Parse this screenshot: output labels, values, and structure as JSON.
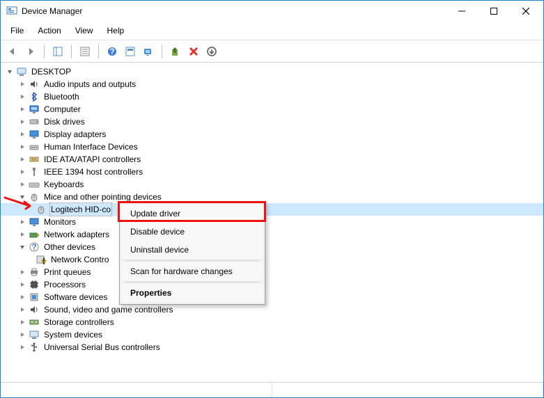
{
  "window": {
    "title": "Device Manager"
  },
  "menubar": {
    "file": "File",
    "action": "Action",
    "view": "View",
    "help": "Help"
  },
  "tree": {
    "root": "DESKTOP",
    "audio": "Audio inputs and outputs",
    "bluetooth": "Bluetooth",
    "computer": "Computer",
    "diskdrives": "Disk drives",
    "display": "Display adapters",
    "hid": "Human Interface Devices",
    "ide": "IDE ATA/ATAPI controllers",
    "ieee": "IEEE 1394 host controllers",
    "keyboards": "Keyboards",
    "mice": "Mice and other pointing devices",
    "logitech": "Logitech HID-co",
    "monitors": "Monitors",
    "network": "Network adapters",
    "other": "Other devices",
    "networkcontroller": "Network Contro",
    "printq": "Print queues",
    "processors": "Processors",
    "software": "Software devices",
    "sound": "Sound, video and game controllers",
    "storage": "Storage controllers",
    "system": "System devices",
    "usb": "Universal Serial Bus controllers"
  },
  "contextmenu": {
    "update": "Update driver",
    "disable": "Disable device",
    "uninstall": "Uninstall device",
    "scan": "Scan for hardware changes",
    "properties": "Properties"
  }
}
